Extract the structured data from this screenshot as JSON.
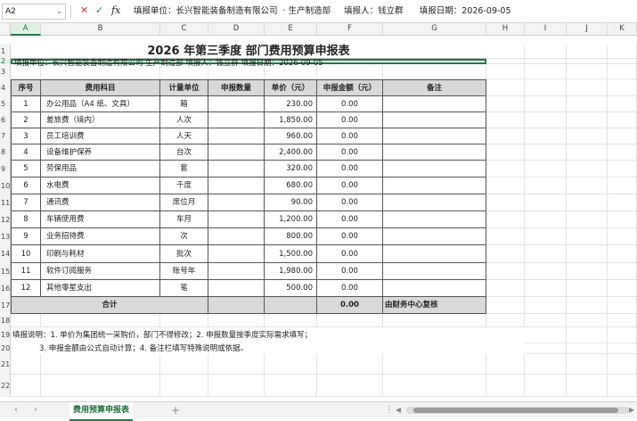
{
  "formula_bar": {
    "name_box": "A2",
    "cancel_icon": "✕",
    "confirm_icon": "✓",
    "fx_label": "fx",
    "content": "填报单位：长兴智能装备制造有限公司  · 生产制造部     填报人：钱立群      填报日期：2026-09-05"
  },
  "columns": [
    "A",
    "B",
    "C",
    "D",
    "E",
    "F",
    "G",
    "H",
    "I",
    "J",
    "K"
  ],
  "rows": [
    "1",
    "2",
    "3",
    "4",
    "5",
    "6",
    "7",
    "8",
    "9",
    "10",
    "11",
    "12",
    "13",
    "14",
    "15",
    "16",
    "17",
    "18",
    "19",
    "20",
    "21",
    "22"
  ],
  "title": "2026 年第三季度 部门费用预算申报表",
  "info_row": "填报单位：长兴智能装备制造有限公司  生产制造部        填报人：钱立群        填报日期：2026-09-05",
  "table": {
    "headers": [
      "序号",
      "费用科目",
      "计量单位",
      "申报数量",
      "单价（元）",
      "申报金额（元）",
      "备注"
    ],
    "items": [
      {
        "no": "1",
        "name": "办公用品（A4 纸、文具）",
        "unit": "箱",
        "qty": "",
        "price": "230.00",
        "amount": "0.00",
        "note": ""
      },
      {
        "no": "2",
        "name": "差旅费（境内）",
        "unit": "人次",
        "qty": "",
        "price": "1,850.00",
        "amount": "0.00",
        "note": ""
      },
      {
        "no": "3",
        "name": "员工培训费",
        "unit": "人天",
        "qty": "",
        "price": "960.00",
        "amount": "0.00",
        "note": ""
      },
      {
        "no": "4",
        "name": "设备维护保养",
        "unit": "台次",
        "qty": "",
        "price": "2,400.00",
        "amount": "0.00",
        "note": ""
      },
      {
        "no": "5",
        "name": "劳保用品",
        "unit": "套",
        "qty": "",
        "price": "320.00",
        "amount": "0.00",
        "note": ""
      },
      {
        "no": "6",
        "name": "水电费",
        "unit": "千度",
        "qty": "",
        "price": "680.00",
        "amount": "0.00",
        "note": ""
      },
      {
        "no": "7",
        "name": "通讯费",
        "unit": "席位月",
        "qty": "",
        "price": "90.00",
        "amount": "0.00",
        "note": ""
      },
      {
        "no": "8",
        "name": "车辆使用费",
        "unit": "车月",
        "qty": "",
        "price": "1,200.00",
        "amount": "0.00",
        "note": ""
      },
      {
        "no": "9",
        "name": "业务招待费",
        "unit": "次",
        "qty": "",
        "price": "800.00",
        "amount": "0.00",
        "note": ""
      },
      {
        "no": "10",
        "name": "印刷与耗材",
        "unit": "批次",
        "qty": "",
        "price": "1,500.00",
        "amount": "0.00",
        "note": ""
      },
      {
        "no": "11",
        "name": "软件订阅服务",
        "unit": "账号年",
        "qty": "",
        "price": "1,980.00",
        "amount": "0.00",
        "note": ""
      },
      {
        "no": "12",
        "name": "其他零星支出",
        "unit": "笔",
        "qty": "",
        "price": "500.00",
        "amount": "0.00",
        "note": ""
      }
    ],
    "total_label": "合计",
    "total_amount": "0.00",
    "total_note": "由财务中心复核"
  },
  "notes": {
    "line1": "填报说明：1. 单价为集团统一采购价，部门不得修改；2. 申报数量按季度实际需求填写；",
    "line2": "3. 申报金额由公式自动计算；4. 备注栏填写特殊说明或依据。"
  },
  "sheet_tab": "费用预算申报表",
  "add_sheet": "+"
}
